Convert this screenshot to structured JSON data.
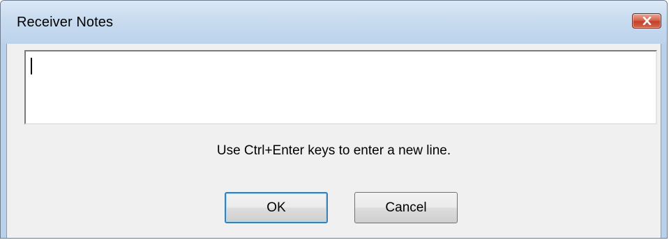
{
  "window": {
    "title": "Receiver Notes",
    "close_icon": "close-icon"
  },
  "notes": {
    "value": "",
    "placeholder": ""
  },
  "hint": "Use Ctrl+Enter keys to enter a new line.",
  "buttons": {
    "ok_label": "OK",
    "cancel_label": "Cancel"
  },
  "colors": {
    "titlebar": "#c8dbef",
    "close_button": "#c2412a",
    "client_background": "#f0f0f0",
    "default_button_border": "#3c7fb1"
  }
}
